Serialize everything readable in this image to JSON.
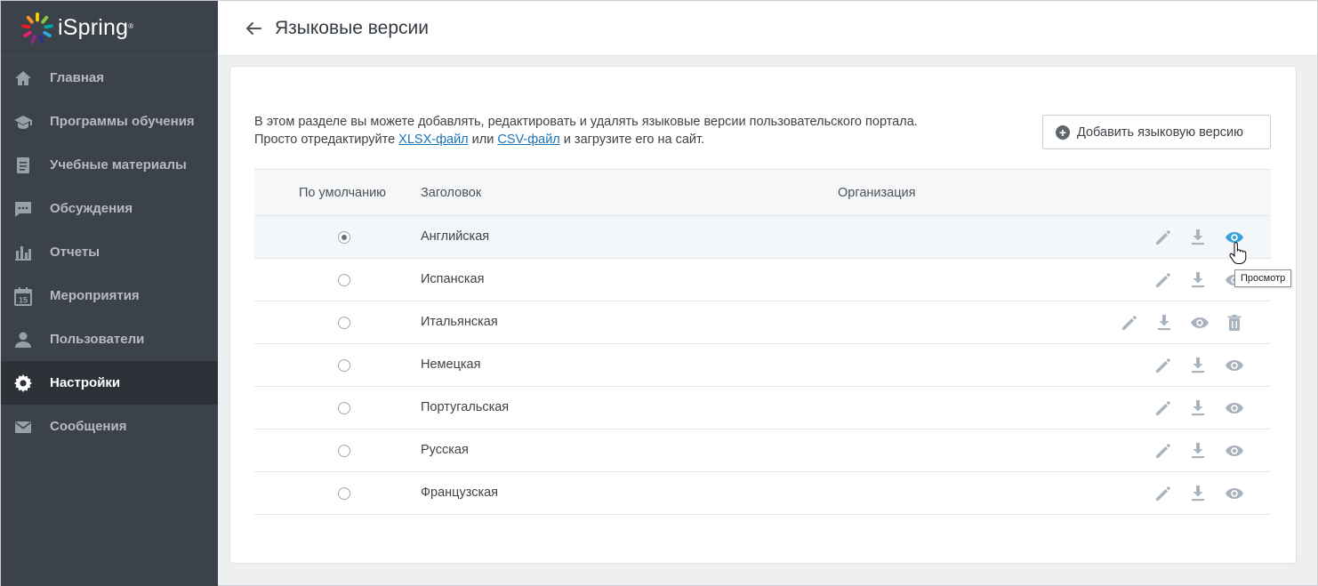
{
  "app": {
    "logo_text": "iSpring",
    "logo_mark": "®"
  },
  "sidebar": {
    "items": [
      {
        "label": "Главная",
        "icon": "home-icon",
        "active": false
      },
      {
        "label": "Программы обучения",
        "icon": "graduation-cap-icon",
        "active": false
      },
      {
        "label": "Учебные материалы",
        "icon": "document-icon",
        "active": false
      },
      {
        "label": "Обсуждения",
        "icon": "chat-icon",
        "active": false
      },
      {
        "label": "Отчеты",
        "icon": "bar-chart-icon",
        "active": false
      },
      {
        "label": "Мероприятия",
        "icon": "calendar-icon",
        "active": false
      },
      {
        "label": "Пользователи",
        "icon": "user-icon",
        "active": false
      },
      {
        "label": "Настройки",
        "icon": "gear-icon",
        "active": true
      },
      {
        "label": "Сообщения",
        "icon": "envelope-icon",
        "active": false
      }
    ]
  },
  "header": {
    "title": "Языковые версии"
  },
  "intro": {
    "line1": "В этом разделе вы можете добавлять, редактировать и удалять языковые версии пользовательского портала.",
    "line2_prefix": "Просто отредактируйте ",
    "xlsx_link": "XLSX-файл",
    "middle": " или ",
    "csv_link": "CSV-файл",
    "line2_suffix": " и загрузите его на сайт."
  },
  "add_button": {
    "label": "Добавить языковую версию"
  },
  "table": {
    "columns": {
      "default": "По умолчанию",
      "title": "Заголовок",
      "organization": "Организация"
    },
    "rows": [
      {
        "title": "Английская",
        "organization": "",
        "default": true,
        "hover": true,
        "delete": false
      },
      {
        "title": "Испанская",
        "organization": "",
        "default": false,
        "hover": false,
        "delete": false
      },
      {
        "title": "Итальянская",
        "organization": "",
        "default": false,
        "hover": false,
        "delete": true
      },
      {
        "title": "Немецкая",
        "organization": "",
        "default": false,
        "hover": false,
        "delete": false
      },
      {
        "title": "Португальская",
        "organization": "",
        "default": false,
        "hover": false,
        "delete": false
      },
      {
        "title": "Русская",
        "organization": "",
        "default": false,
        "hover": false,
        "delete": false
      },
      {
        "title": "Французская",
        "organization": "",
        "default": false,
        "hover": false,
        "delete": false
      }
    ]
  },
  "tooltip": {
    "text": "Просмотр"
  },
  "colors": {
    "sidebar_bg": "#3b4249",
    "sidebar_active": "#2c3237",
    "link": "#1a73b5",
    "icon_muted": "#a9b3bd",
    "icon_active": "#3aa4dc"
  }
}
